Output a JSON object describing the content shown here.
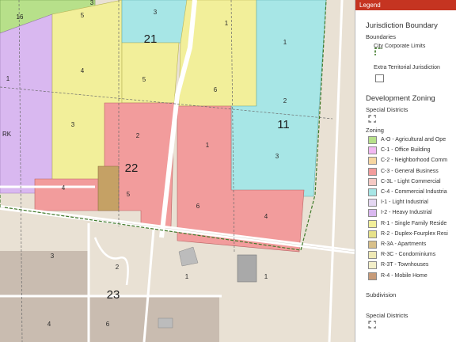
{
  "map": {
    "district_labels": [
      "21",
      "22",
      "23",
      "11",
      "16",
      "3",
      "RK"
    ],
    "parcel_labels": [
      "1",
      "2",
      "3",
      "4",
      "5",
      "6"
    ]
  },
  "legend": {
    "header": "Legend",
    "jurisdiction_title": "Jurisdiction Boundary",
    "boundaries_label": "Boundaries",
    "city_limits": "City Corporate Limits",
    "etj": "Extra Territorial Jurisdiction",
    "dev_zoning_title": "Development Zoning",
    "special_districts_label": "Special Districts",
    "zoning_label": "Zoning",
    "zoning_items": [
      {
        "label": "A-O - Agricultural and Ope",
        "color": "#b7e08a"
      },
      {
        "label": "C-1 - Office Building",
        "color": "#f2b8f2"
      },
      {
        "label": "C-2 - Neighborhood Comm",
        "color": "#f7d6a1"
      },
      {
        "label": "C-3 - General Business",
        "color": "#f29c9c"
      },
      {
        "label": "C-3L - Light Commercial",
        "color": "#f6c9c4"
      },
      {
        "label": "C-4 - Commercial Industria",
        "color": "#a7e6e6"
      },
      {
        "label": "I-1 - Light Industrial",
        "color": "#e4d7f2"
      },
      {
        "label": "I-2 - Heavy Industrial",
        "color": "#d9b8f0"
      },
      {
        "label": "R-1 - Single Family Reside",
        "color": "#f2ef9a"
      },
      {
        "label": "R-2 - Duplex-Fourplex Resi",
        "color": "#e7e28a"
      },
      {
        "label": "R-3A - Apartments",
        "color": "#d8c08a"
      },
      {
        "label": "R-3C - Condominiums",
        "color": "#efe9b5"
      },
      {
        "label": "R-3T - Townhouses",
        "color": "#f3efc9"
      },
      {
        "label": "R-4 - Mobile Home",
        "color": "#c79b79"
      }
    ],
    "subdivision_label": "Subdivision",
    "special_districts_label_2": "Special Districts"
  },
  "colors": {
    "agricultural": "#b7e08a",
    "heavy_industrial": "#d9b8f0",
    "single_family": "#f2ef9a",
    "general_business": "#f29c9c",
    "commercial_industrial": "#a7e6e6",
    "apartments": "#c5a165",
    "basemap": "#e9e1d4",
    "basemap_dark": "#c9bcb0",
    "road": "#ffffff",
    "boundary": "#3f7a2a",
    "legend_header": "#c53421"
  }
}
